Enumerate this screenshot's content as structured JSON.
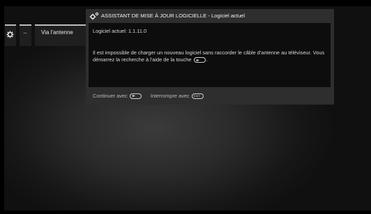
{
  "tiles": {
    "settings_icon": "gear-icon",
    "dots_label": "···",
    "antenna_label": "Via l'antenne"
  },
  "dialog": {
    "icon": "gears-icon",
    "title": "ASSISTANT DE MISE À JOUR LOGICIELLE - Logiciel actuel",
    "version_text": "Logiciel actuel: 1.1.11.0",
    "message_part1": "Il est impossible de charger un nouveau logiciel sans raccorder le câble d'antenne au téléviseur. Vous démarrez la recherche à l'aide de la touche",
    "message_part2": ".",
    "continue_label": "Continuer avec",
    "interrupt_label": "Interrompre avec",
    "key_ff_icon": "fast-forward-key-icon",
    "key_exit_icon": "exit-key-icon"
  },
  "colors": {
    "background": "#000000",
    "dialog_frame": "#2e2e2e",
    "dialog_body": "#0d0d0d",
    "text": "#d8d8d8"
  }
}
